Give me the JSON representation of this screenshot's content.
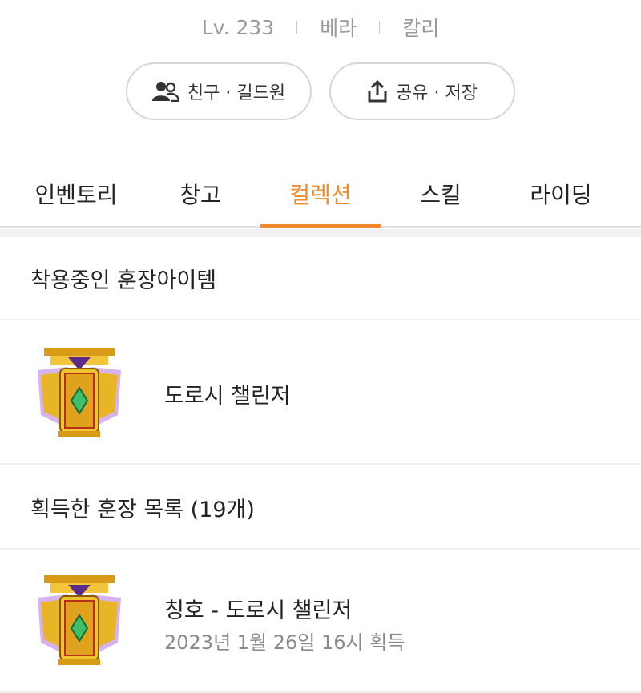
{
  "profile": {
    "level": "Lv. 233",
    "world": "베라",
    "job": "칼리"
  },
  "actions": {
    "friends_label": "친구 · 길드원",
    "friends_icon": "people-icon",
    "share_label": "공유 · 저장",
    "share_icon": "share-icon"
  },
  "tabs": [
    {
      "label": "인벤토리"
    },
    {
      "label": "창고"
    },
    {
      "label": "컬렉션"
    },
    {
      "label": "스킬"
    },
    {
      "label": "라이딩"
    }
  ],
  "active_tab": "컬렉션",
  "accent_color": "#f08a2c",
  "equipped": {
    "header": "착용중인 훈장아이템",
    "item_name": "도로시 챌린저"
  },
  "acquired": {
    "header": "획득한 훈장 목록 (19개)",
    "items": [
      {
        "name": "칭호 - 도로시 챌린저",
        "date": "2023년 1월 26일 16시  획득"
      }
    ]
  }
}
